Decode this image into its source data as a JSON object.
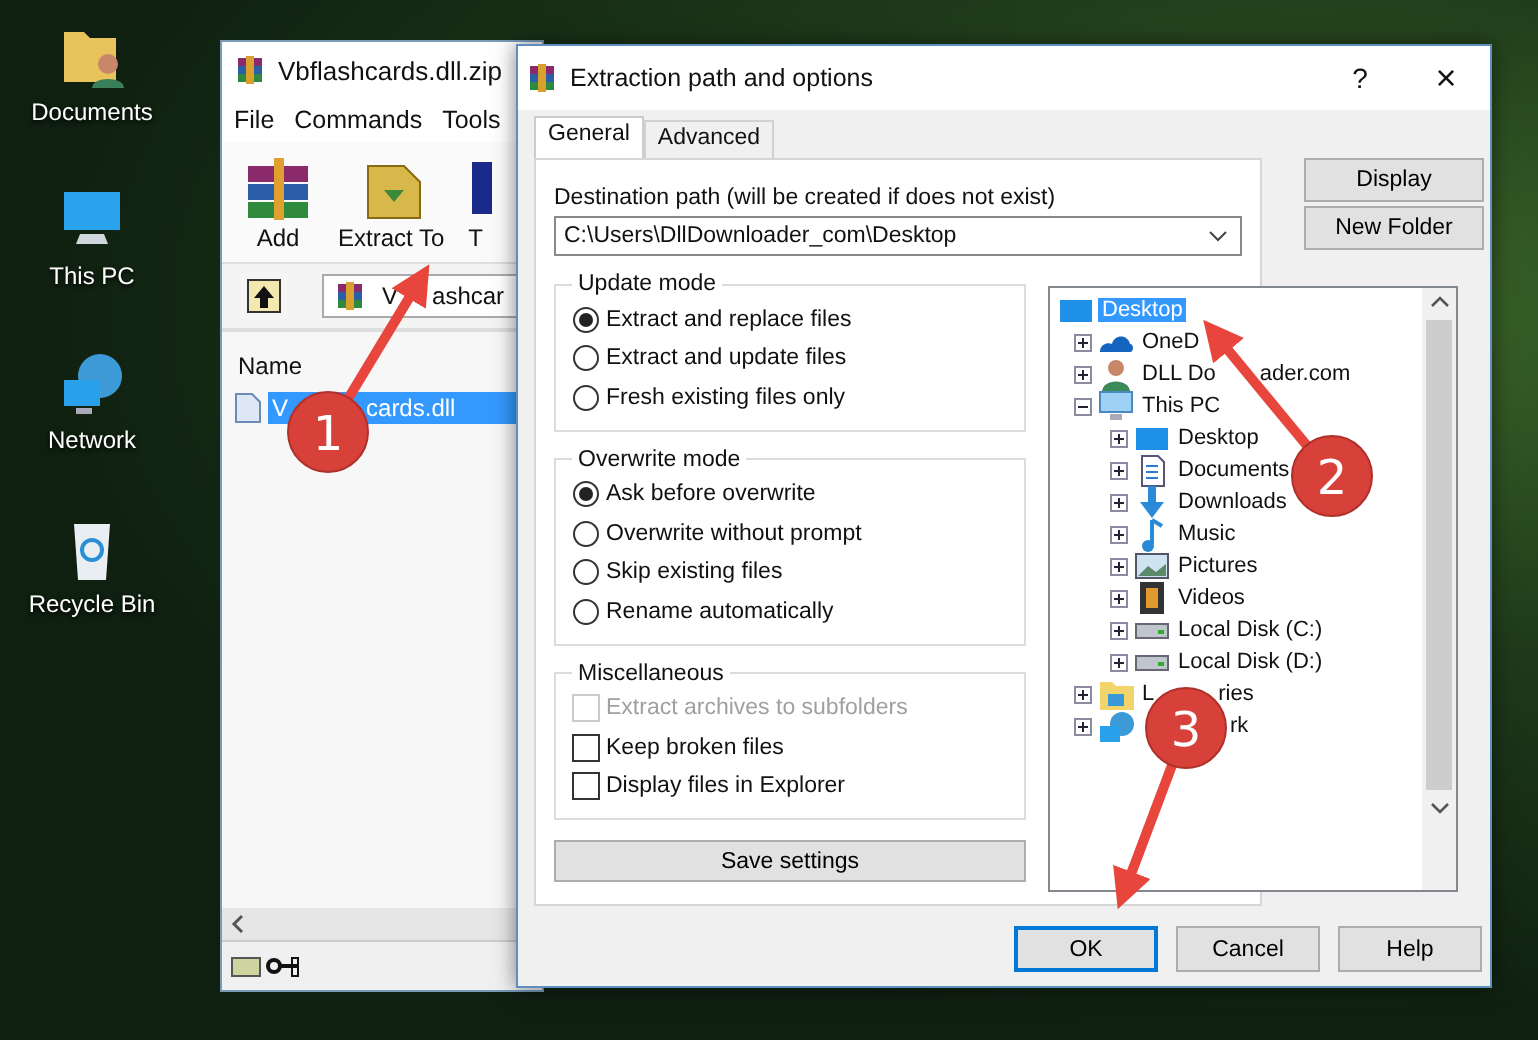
{
  "desktop_icons": [
    {
      "label": "Documents",
      "kind": "user-folder"
    },
    {
      "label": "This PC",
      "kind": "computer"
    },
    {
      "label": "Network",
      "kind": "network"
    },
    {
      "label": "Recycle Bin",
      "kind": "bin"
    }
  ],
  "archive_window": {
    "title": "Vbflashcards.dll.zip",
    "menu": [
      "File",
      "Commands",
      "Tools"
    ],
    "toolbar": [
      {
        "label": "Add",
        "kind": "books"
      },
      {
        "label": "Extract To",
        "kind": "extract"
      },
      {
        "label": "T",
        "kind": "test"
      }
    ],
    "address": [
      "V",
      "ashcar"
    ],
    "columns": [
      "Name"
    ],
    "files": [
      {
        "name": [
          "V",
          "cards.dll"
        ],
        "selected": true
      }
    ]
  },
  "dialog": {
    "title": "Extraction path and options",
    "help": "?",
    "close": "×",
    "tabs": [
      {
        "label": "General",
        "selected": true
      },
      {
        "label": "Advanced",
        "selected": false
      }
    ],
    "destination_label": "Destination path (will be created if does not exist)",
    "destination_path": "C:\\Users\\DllDownloader_com\\Desktop",
    "side_buttons": [
      "Display",
      "New Folder"
    ],
    "groups": [
      {
        "title": "Update mode",
        "kind": "radio",
        "options": [
          {
            "label": "Extract and replace files",
            "checked": true,
            "disabled": false
          },
          {
            "label": "Extract and update files",
            "checked": false,
            "disabled": false
          },
          {
            "label": "Fresh existing files only",
            "checked": false,
            "disabled": false
          }
        ]
      },
      {
        "title": "Overwrite mode",
        "kind": "radio",
        "options": [
          {
            "label": "Ask before overwrite",
            "checked": true,
            "disabled": false
          },
          {
            "label": "Overwrite without prompt",
            "checked": false,
            "disabled": false
          },
          {
            "label": "Skip existing files",
            "checked": false,
            "disabled": false
          },
          {
            "label": "Rename automatically",
            "checked": false,
            "disabled": false
          }
        ]
      },
      {
        "title": "Miscellaneous",
        "kind": "checkbox",
        "options": [
          {
            "label": "Extract archives to subfolders",
            "checked": false,
            "disabled": true
          },
          {
            "label": "Keep broken files",
            "checked": false,
            "disabled": false
          },
          {
            "label": "Display files in Explorer",
            "checked": false,
            "disabled": false
          }
        ]
      }
    ],
    "save_button": "Save settings",
    "tree": [
      {
        "label": "Desktop",
        "kind": "desktop",
        "selected": true,
        "children": [
          {
            "label": "OneD",
            "kind": "cloud",
            "selected": false,
            "expanded": false
          },
          {
            "label": [
              "DLL Do",
              "ader.com"
            ],
            "kind": "user",
            "selected": false,
            "expanded": false
          },
          {
            "label": "This PC",
            "kind": "computer",
            "selected": false,
            "expanded": true,
            "children": [
              {
                "label": "Desktop",
                "kind": "desktop",
                "selected": false,
                "expanded": false
              },
              {
                "label": "Documents",
                "kind": "documents",
                "selected": false,
                "expanded": false
              },
              {
                "label": "Downloads",
                "kind": "downloads",
                "selected": false,
                "expanded": false
              },
              {
                "label": "Music",
                "kind": "music",
                "selected": false,
                "expanded": false
              },
              {
                "label": "Pictures",
                "kind": "pictures",
                "selected": false,
                "expanded": false
              },
              {
                "label": "Videos",
                "kind": "videos",
                "selected": false,
                "expanded": false
              },
              {
                "label": "Local Disk (C:)",
                "kind": "disk",
                "selected": false,
                "expanded": false
              },
              {
                "label": "Local Disk (D:)",
                "kind": "disk",
                "selected": false,
                "expanded": false
              }
            ]
          },
          {
            "label": [
              "L",
              "ries"
            ],
            "kind": "libraries",
            "selected": false,
            "expanded": false
          },
          {
            "label": [
              "rk"
            ],
            "kind": "network",
            "selected": false,
            "expanded": false
          }
        ]
      }
    ],
    "buttons": [
      {
        "label": "OK",
        "default": true
      },
      {
        "label": "Cancel",
        "default": false
      },
      {
        "label": "Help",
        "default": false
      }
    ]
  },
  "annotations": [
    {
      "number": "1"
    },
    {
      "number": "2"
    },
    {
      "number": "3"
    }
  ]
}
